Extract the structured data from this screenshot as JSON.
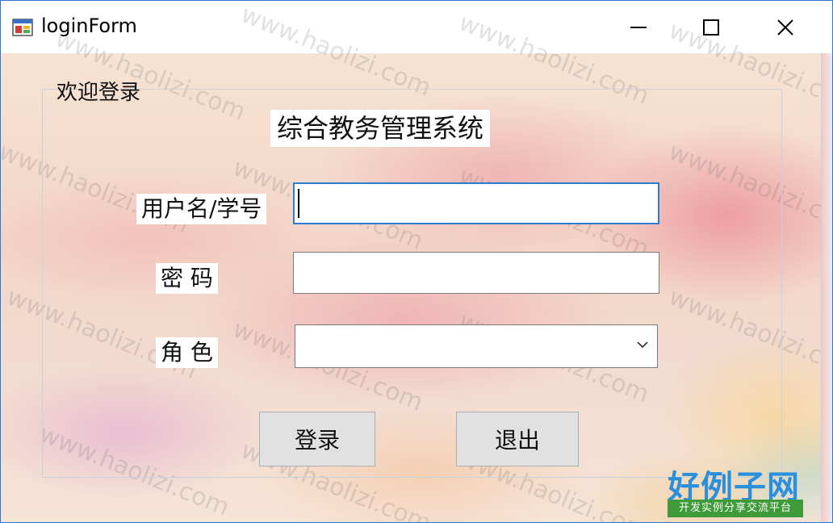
{
  "window": {
    "title": "loginForm",
    "minimize_icon": "minimize-icon",
    "maximize_icon": "maximize-icon",
    "close_icon": "close-icon"
  },
  "groupbox": {
    "title": "欢迎登录"
  },
  "system_title": "综合教务管理系统",
  "fields": {
    "username_label": "用户名/学号",
    "username_value": "",
    "password_label": "密 码",
    "password_value": "",
    "role_label": "角 色",
    "role_value": ""
  },
  "buttons": {
    "login": "登录",
    "exit": "退出"
  },
  "watermark_text": "www.haolizi.com",
  "logo": {
    "main": "好例子网",
    "sub": "开发实例分享交流平台"
  },
  "colors": {
    "focus_border": "#2d7bd6",
    "window_border": "#2b78d4",
    "button_bg": "#e1e1e1",
    "logo_blue": "#2a8fdc",
    "logo_green": "#3f9a3a"
  }
}
